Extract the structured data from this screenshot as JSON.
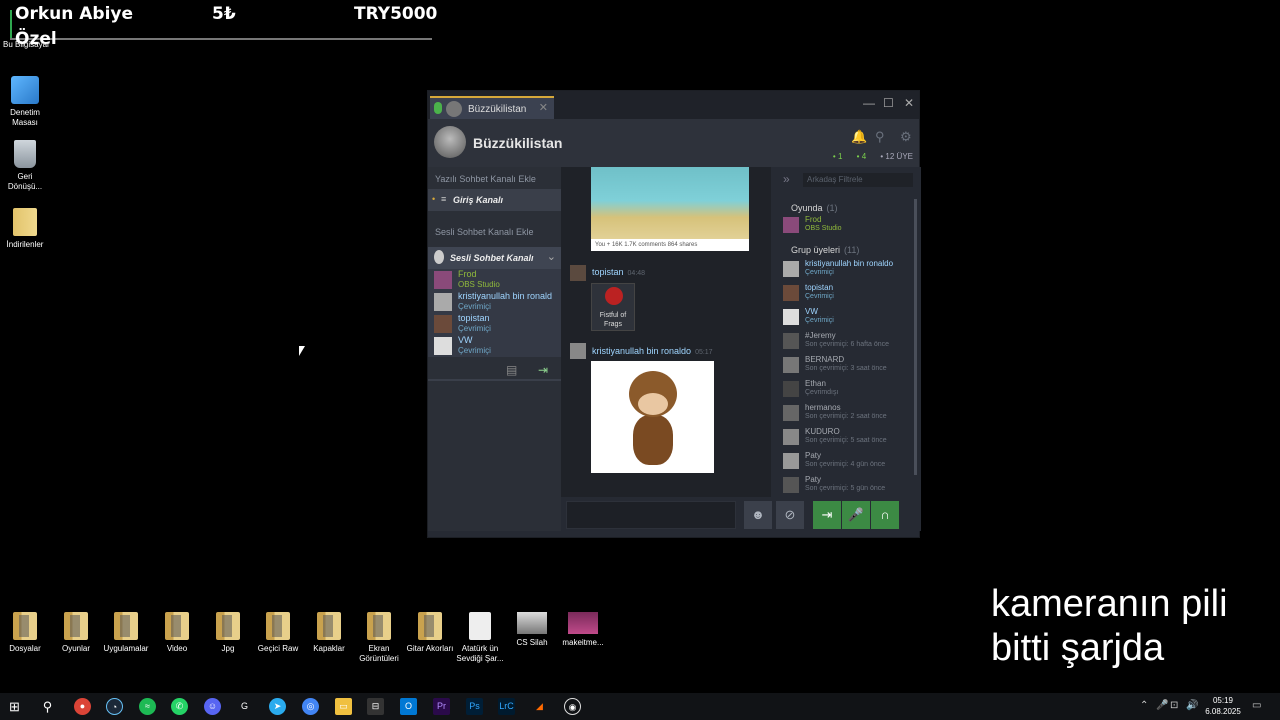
{
  "overlay": {
    "name": "Orkun Abiye",
    "amount_small": "5₺",
    "amount": "TRY5000",
    "label": "Özel",
    "pc_label": "Bu Bilgisayar"
  },
  "desktop": {
    "top_icons": [
      {
        "label_line1": "Denetim",
        "label_line2": "Masası",
        "icon": "control-panel-icon"
      },
      {
        "label_line1": "Geri",
        "label_line2": "Dönüşü...",
        "icon": "recycle-bin-icon"
      },
      {
        "label_line1": "İndirilenler",
        "label_line2": "",
        "icon": "downloads-folder-icon"
      }
    ],
    "bottom_icons": [
      {
        "label_line1": "Dosyalar",
        "label_line2": ""
      },
      {
        "label_line1": "Oyunlar",
        "label_line2": ""
      },
      {
        "label_line1": "Uygulamalar",
        "label_line2": ""
      },
      {
        "label_line1": "Video",
        "label_line2": ""
      },
      {
        "label_line1": "Jpg",
        "label_line2": ""
      },
      {
        "label_line1": "Geçici Raw",
        "label_line2": ""
      },
      {
        "label_line1": "Kapaklar",
        "label_line2": ""
      },
      {
        "label_line1": "Ekran",
        "label_line2": "Görüntüleri"
      },
      {
        "label_line1": "Gitar Akorları",
        "label_line2": ""
      },
      {
        "label_line1": "Atatürk ün",
        "label_line2": "Sevdiği Şar..."
      },
      {
        "label_line1": "CS Silah",
        "label_line2": ""
      },
      {
        "label_line1": "makeitme...",
        "label_line2": ""
      }
    ]
  },
  "steam": {
    "tab_title": "Büzzükilistan",
    "group_name": "Büzzükilistan",
    "counts": {
      "in_game": "1",
      "online": "4",
      "members": "12 ÜYE"
    },
    "left": {
      "add_text_channel": "Yazılı Sohbet Kanalı Ekle",
      "entry_channel": "Giriş Kanalı",
      "add_voice_channel": "Sesli Sohbet Kanalı Ekle",
      "voice_channel": "Sesli Sohbet Kanalı",
      "voice_members": [
        {
          "name": "Frod",
          "status": "OBS Studio",
          "game": true
        },
        {
          "name": "kristiyanullah bin ronaldo",
          "status": "Çevrimiçi",
          "game": false
        },
        {
          "name": "topistan",
          "status": "Çevrimiçi",
          "game": false
        },
        {
          "name": "VW",
          "status": "Çevrimiçi",
          "game": false
        }
      ]
    },
    "chat": {
      "beach_bar": "You + 16K   1.7K comments  864 shares",
      "msg1_name": "topistan",
      "msg1_time": "04:48",
      "msg1_attachment_line1": "Fistful of",
      "msg1_attachment_line2": "Frags",
      "msg2_name": "kristiyanullah bin ronaldo",
      "msg2_time": "05:17"
    },
    "members": {
      "search_placeholder": "Arkadaş Filtrele",
      "in_game_label": "Oyunda",
      "in_game_count": "(1)",
      "group_label": "Grup üyeleri",
      "group_count": "(11)",
      "in_game": [
        {
          "name": "Frod",
          "status": "OBS Studio"
        }
      ],
      "list": [
        {
          "name": "kristiyanullah bin ronaldo",
          "status": "Çevrimiçi",
          "online": true
        },
        {
          "name": "topistan",
          "status": "Çevrimiçi",
          "online": true
        },
        {
          "name": "VW",
          "status": "Çevrimiçi",
          "online": true
        },
        {
          "name": "#Jeremy",
          "status": "Son çevrimiçi: 6 hafta önce",
          "online": false
        },
        {
          "name": "BERNARD",
          "status": "Son çevrimiçi: 3 saat önce",
          "online": false
        },
        {
          "name": "Ethan",
          "status": "Çevrimdışı",
          "online": false
        },
        {
          "name": "hermanos",
          "status": "Son çevrimiçi: 2 saat önce",
          "online": false
        },
        {
          "name": "KUDURO",
          "status": "Son çevrimiçi: 5 saat önce",
          "online": false
        },
        {
          "name": "Paty",
          "status": "Son çevrimiçi: 4 gün önce",
          "online": false
        },
        {
          "name": "Paty",
          "status": "Son çevrimiçi: 5 gün önce",
          "online": false
        }
      ]
    }
  },
  "caption": {
    "line1": "kameranın pili",
    "line2": "bitti şarjda"
  },
  "taskbar": {
    "time": "05:19",
    "date": "6.08.2025"
  },
  "colors": {
    "online": "#9fd5ff",
    "in_game": "#90ba3c",
    "accent": "#3c8a44"
  }
}
